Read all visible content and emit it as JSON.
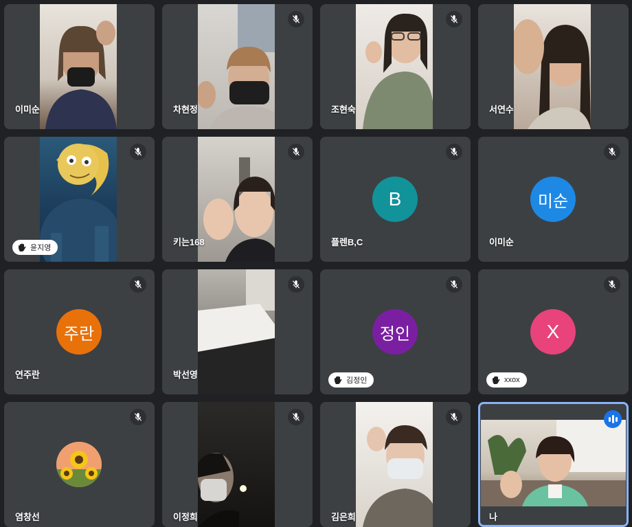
{
  "participants": [
    {
      "name": "이미순"
    },
    {
      "name": "차현정"
    },
    {
      "name": "조현숙"
    },
    {
      "name": "서연수"
    },
    {
      "name": "윤지영"
    },
    {
      "name": "키는168"
    },
    {
      "name": "플렌B,C",
      "avatar_text": "B",
      "avatar_color": "#12939a"
    },
    {
      "name": "이미순",
      "avatar_text": "미순",
      "avatar_color": "#1e88e5"
    },
    {
      "name": "연주란",
      "avatar_text": "주란",
      "avatar_color": "#e8710a"
    },
    {
      "name": "박선영"
    },
    {
      "name": "김정인",
      "avatar_text": "정인",
      "avatar_color": "#7b1fa2"
    },
    {
      "name": "xxox",
      "avatar_text": "X",
      "avatar_color": "#e8437a"
    },
    {
      "name": "염창선"
    },
    {
      "name": "이정희"
    },
    {
      "name": "김은희"
    },
    {
      "name": "나"
    }
  ],
  "icons": {
    "mute": "mic-off-icon",
    "hand": "raised-hand-icon",
    "speaking": "audio-level-icon",
    "profile_photo": "sunflower-avatar"
  },
  "colors": {
    "background": "#202124",
    "tile": "#3c4043",
    "active_speaker": "#8ab4f8",
    "speaking_indicator": "#1a73e8"
  }
}
